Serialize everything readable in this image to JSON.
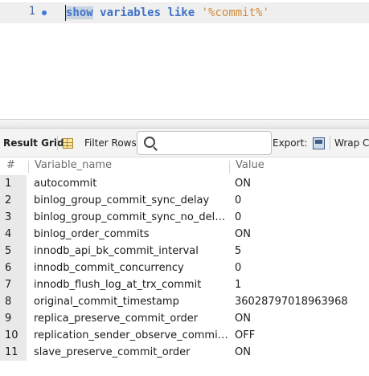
{
  "editor": {
    "line_number": "1",
    "sql": {
      "kw_show": "show",
      "kw_variables": "variables",
      "kw_like": "like",
      "pattern": "'%commit%'"
    }
  },
  "toolbar": {
    "result_grid_label": "Result Grid",
    "filter_rows_label": "Filter Rows:",
    "filter_rows_value": "",
    "export_label": "Export:",
    "wrap_label": "Wrap Ce"
  },
  "grid": {
    "columns": [
      "#",
      "Variable_name",
      "Value"
    ],
    "rows": [
      {
        "num": "1",
        "name": "autocommit",
        "value": "ON"
      },
      {
        "num": "2",
        "name": "binlog_group_commit_sync_delay",
        "value": "0"
      },
      {
        "num": "3",
        "name": "binlog_group_commit_sync_no_del…",
        "value": "0"
      },
      {
        "num": "4",
        "name": "binlog_order_commits",
        "value": "ON"
      },
      {
        "num": "5",
        "name": "innodb_api_bk_commit_interval",
        "value": "5"
      },
      {
        "num": "6",
        "name": "innodb_commit_concurrency",
        "value": "0"
      },
      {
        "num": "7",
        "name": "innodb_flush_log_at_trx_commit",
        "value": "1"
      },
      {
        "num": "8",
        "name": "original_commit_timestamp",
        "value": "36028797018963968"
      },
      {
        "num": "9",
        "name": "replica_preserve_commit_order",
        "value": "ON"
      },
      {
        "num": "10",
        "name": "replication_sender_observe_commi…",
        "value": "OFF"
      },
      {
        "num": "11",
        "name": "slave_preserve_commit_order",
        "value": "ON"
      }
    ]
  },
  "colors": {
    "keyword": "#3f73c8",
    "string": "#d18a3c",
    "current_line": "#efefef"
  },
  "icons": {
    "grid": "grid-icon",
    "search": "search-icon",
    "export": "export-icon",
    "exec": "execution-dot-icon"
  }
}
